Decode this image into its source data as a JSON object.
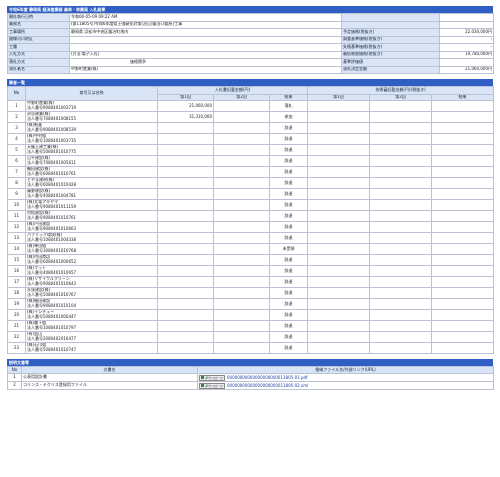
{
  "header": {
    "title": "令和6年度 静岡県 経済産業部 森林・林業局 入札結果"
  },
  "info": {
    "rows": [
      {
        "l1": "開札執行日時",
        "v1": "令和06-05-09 09:22 AM",
        "l2": "",
        "v2": ""
      },
      {
        "l1": "業務名",
        "v1": "(第11805号)令和6年度県土強靭化対策(治山)鍛冶(3箇所)工事",
        "l2": "",
        "v2": ""
      },
      {
        "l1": "工事場所",
        "v1": "静岡県 浜松市中央区鍛冶町地内",
        "l2": "予定価格(税抜き)",
        "v2": "22,030,000円"
      },
      {
        "l1": "路線河川地区",
        "v1": "",
        "l2": "調査基準価格(税抜き)",
        "v2": "-"
      },
      {
        "l1": "工種",
        "v1": "",
        "l2": "失格基準価格(税抜き)",
        "v2": "-"
      },
      {
        "l1": "入札方式",
        "v1": "(方法:電子入札)",
        "l2": "最低制限価格(税抜き)",
        "v2": "19,780,000円"
      },
      {
        "l1": "落札方式",
        "v1": "価格競争",
        "l2": "基準評価値",
        "v2": ""
      },
      {
        "l1": "落札者名",
        "v1": "中野町産業(株)",
        "l2": "落札決定金額",
        "v2": "21,060,000円"
      }
    ]
  },
  "bidders_section": {
    "title": "業者一覧",
    "col_no": "No",
    "col_name": "商号又は名称",
    "col_bid_group": "入札書記載金額(円)",
    "col_tech_group": "技術審記載金額(円)(税抜き)",
    "col_round1": "第1回",
    "col_round2": "第2回",
    "col_result": "結果"
  },
  "bidders": [
    {
      "no": "1",
      "name": "中野町産業(株)",
      "reg": "法人番号9080401003719",
      "b1": "21,060,000",
      "b2": "",
      "result": "落札"
    },
    {
      "no": "2",
      "name": "渋谷建業(株)",
      "reg": "法人番号7080401008155",
      "b1": "31,310,000",
      "b2": "",
      "result": "参加"
    },
    {
      "no": "3",
      "name": "(株)新進",
      "reg": "法人番号9080401008539",
      "b1": "",
      "b2": "",
      "result": "辞退"
    },
    {
      "no": "4",
      "name": "(株)中村組",
      "reg": "法人番号1080401003735",
      "b1": "",
      "b2": "",
      "result": "辞退"
    },
    {
      "no": "5",
      "name": "天龍土建工業(株)",
      "reg": "法人番号5080401010775",
      "b1": "",
      "b2": "",
      "result": "辞退"
    },
    {
      "no": "6",
      "name": "山平建設(株)",
      "reg": "法人番号7080401005611",
      "b1": "",
      "b2": "",
      "result": "辞退"
    },
    {
      "no": "7",
      "name": "鶴田建設(株)",
      "reg": "法人番号6080401010761",
      "b1": "",
      "b2": "",
      "result": "辞退"
    },
    {
      "no": "8",
      "name": "とやま建材(株)",
      "reg": "法人番号6080401010428",
      "b1": "",
      "b2": "",
      "result": "辞退"
    },
    {
      "no": "9",
      "name": "藤野建設(株)",
      "reg": "法人番号4080401004781",
      "b1": "",
      "b2": "",
      "result": "辞退"
    },
    {
      "no": "10",
      "name": "(株)文竜アキヤマ",
      "reg": "法人番号9080401011159",
      "b1": "",
      "b2": "",
      "result": "辞退"
    },
    {
      "no": "11",
      "name": "村松建設(株)",
      "reg": "法人番号9080401010761",
      "b1": "",
      "b2": "",
      "result": "辞退"
    },
    {
      "no": "12",
      "name": "(株)戸田建設",
      "reg": "法人番号9080401010663",
      "b1": "",
      "b2": "",
      "result": "辞退"
    },
    {
      "no": "13",
      "name": "パブリック環境(株)",
      "reg": "法人番号1080401004338",
      "b1": "",
      "b2": "",
      "result": "辞退"
    },
    {
      "no": "14",
      "name": "(株)神田組",
      "reg": "法人番号3080401010768",
      "b1": "",
      "b2": "",
      "result": "未受領"
    },
    {
      "no": "15",
      "name": "(株)内田商店",
      "reg": "法人番号6080401000652",
      "b1": "",
      "b2": "",
      "result": "辞退"
    },
    {
      "no": "16",
      "name": "(株)マット",
      "reg": "法人番号4080401010657",
      "b1": "",
      "b2": "",
      "result": "辞退"
    },
    {
      "no": "17",
      "name": "(株)リサイクルクリーン",
      "reg": "法人番号9080401010643",
      "b1": "",
      "b2": "",
      "result": "辞退"
    },
    {
      "no": "18",
      "name": "水窪建設(株)",
      "reg": "法人番号5080401010767",
      "b1": "",
      "b2": "",
      "result": "辞退"
    },
    {
      "no": "19",
      "name": "(株)細田建設",
      "reg": "法人番号9080401010104",
      "b1": "",
      "b2": "",
      "result": "辞退"
    },
    {
      "no": "20",
      "name": "(株)イシチュー",
      "reg": "法人番号5080401000447",
      "b1": "",
      "b2": "",
      "result": "辞退"
    },
    {
      "no": "21",
      "name": "(株)森下組",
      "reg": "法人番号1080401010797",
      "b1": "",
      "b2": "",
      "result": "辞退"
    },
    {
      "no": "22",
      "name": "(有)益山",
      "reg": "法人番号2080402016477",
      "b1": "",
      "b2": "",
      "result": "辞退"
    },
    {
      "no": "23",
      "name": "(株)石川組",
      "reg": "法人番号5080401010747",
      "b1": "",
      "b2": "",
      "result": "辞退"
    }
  ],
  "files_section": {
    "title": "説明文書等",
    "col_no": "No",
    "col_doc": "文書名",
    "col_file": "格納ファイル名/外部リンク(URL)",
    "download_label": "ダウンロード"
  },
  "files": [
    {
      "no": "1",
      "doc": "公表用設計書",
      "file": "00000000000000000000011805-01.pdf"
    },
    {
      "no": "2",
      "doc": "コリンズ・テクリス登録用ファイル",
      "file": "00000000000000000000011805-02.xml"
    }
  ]
}
